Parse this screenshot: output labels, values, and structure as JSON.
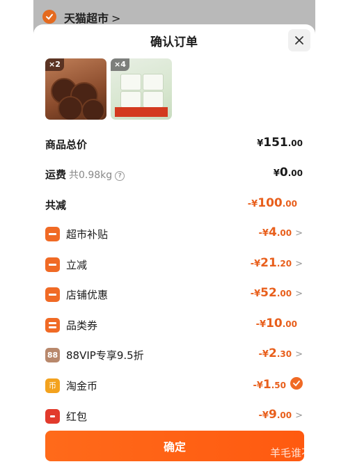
{
  "shop": {
    "name": "天猫超市",
    "chevron": ">"
  },
  "dialog": {
    "title": "确认订单",
    "close_icon": "close-icon"
  },
  "products": [
    {
      "quantity": "×2"
    },
    {
      "quantity": "×4"
    }
  ],
  "summary": {
    "total_label": "商品总价",
    "total_currency": "¥",
    "total_int": "151",
    "total_dec": ".00",
    "shipping_label": "运费",
    "shipping_weight": "共0.98kg",
    "shipping_help": "?",
    "shipping_currency": "¥",
    "shipping_int": "0",
    "shipping_dec": ".00",
    "reduce_label": "共减",
    "reduce_prefix": "-¥",
    "reduce_int": "100",
    "reduce_dec": ".00"
  },
  "discounts": [
    {
      "label": "超市补贴",
      "prefix": "-¥",
      "int": "4",
      "dec": ".00",
      "chevron": ">",
      "icon": "coupon-icon"
    },
    {
      "label": "立减",
      "prefix": "-¥",
      "int": "21",
      "dec": ".20",
      "chevron": ">",
      "icon": "coupon-icon"
    },
    {
      "label": "店铺优惠",
      "prefix": "-¥",
      "int": "52",
      "dec": ".00",
      "chevron": ">",
      "icon": "coupon-icon"
    },
    {
      "label": "品类券",
      "prefix": "-¥",
      "int": "10",
      "dec": ".00",
      "chevron": "",
      "icon": "ticket-icon"
    },
    {
      "label": "88VIP专享9.5折",
      "prefix": "-¥",
      "int": "2",
      "dec": ".30",
      "chevron": ">",
      "icon": "vip-88-icon",
      "icon_text": "88"
    },
    {
      "label": "淘金币",
      "prefix": "-¥",
      "int": "1",
      "dec": ".50",
      "chevron": "",
      "icon": "coin-icon",
      "icon_text": "币",
      "checked": true
    },
    {
      "label": "红包",
      "prefix": "-¥",
      "int": "9",
      "dec": ".00",
      "chevron": ">",
      "icon": "red-packet-icon"
    }
  ],
  "confirm_label": "确定",
  "watermark": "羊毛谁不爱",
  "colors": {
    "accent": "#f06a25",
    "discount_text": "#e85f1c",
    "button": "#ff5f14"
  }
}
